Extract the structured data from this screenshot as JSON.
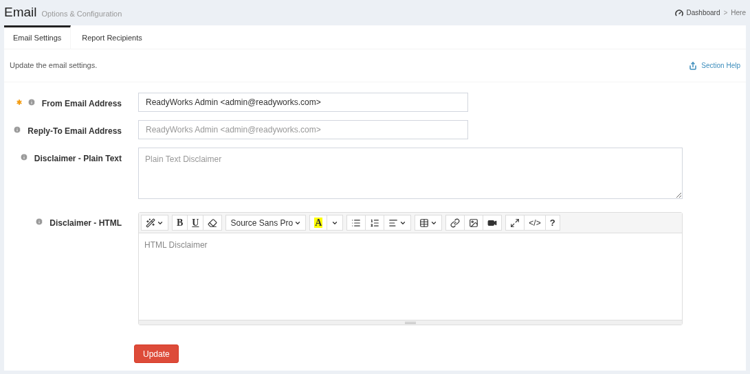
{
  "header": {
    "title": "Email",
    "subtitle": "Options & Configuration",
    "breadcrumb": [
      "Dashboard",
      "Here"
    ],
    "separator": ">"
  },
  "tabs": [
    {
      "label": "Email Settings",
      "selected": true
    },
    {
      "label": "Report Recipients",
      "selected": false
    }
  ],
  "intro": "Update the email settings.",
  "section_help": "Section Help",
  "fields": [
    {
      "kind": "input",
      "label": "From Email Address",
      "required": true,
      "value": "ReadyWorks Admin <admin@readyworks.com>"
    },
    {
      "kind": "input",
      "label": "Reply-To Email Address",
      "required": false,
      "placeholder": "ReadyWorks Admin <admin@readyworks.com>"
    },
    {
      "kind": "textarea",
      "label": "Disclaimer - Plain Text",
      "required": false,
      "placeholder": "Plain Text Disclaimer"
    },
    {
      "kind": "editor",
      "label": "Disclaimer - HTML",
      "required": false,
      "placeholder": "HTML Disclaimer"
    }
  ],
  "toolbar": {
    "bold": "B",
    "underline": "U",
    "font": "Source Sans Pro",
    "text_color_letter": "A",
    "code": "</>",
    "help": "?"
  },
  "submit": "Update"
}
